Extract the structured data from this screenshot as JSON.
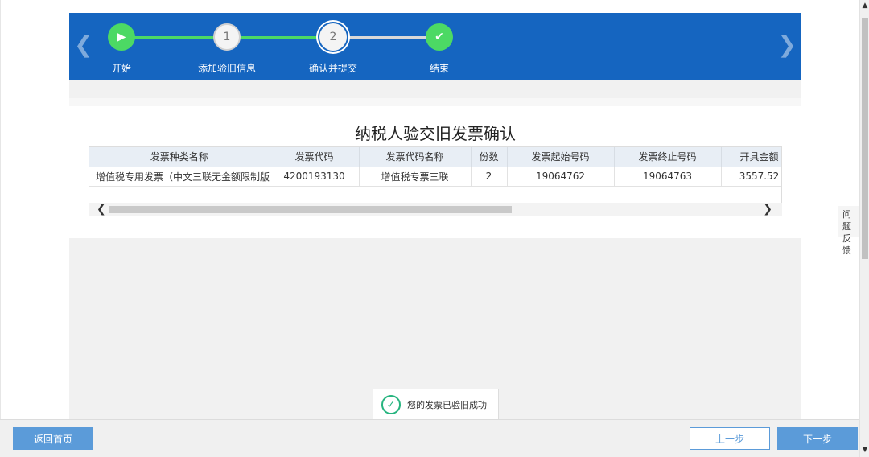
{
  "steps": [
    {
      "label": "开始",
      "marker": "▶",
      "state": "done"
    },
    {
      "label": "添加验旧信息",
      "marker": "1",
      "state": "pending"
    },
    {
      "label": "确认并提交",
      "marker": "2",
      "state": "current"
    },
    {
      "label": "结束",
      "marker": "✔",
      "state": "done"
    }
  ],
  "nav": {
    "prev_icon": "chevron-left-icon",
    "next_icon": "chevron-right-icon",
    "left_glyph": "❮",
    "right_glyph": "❯"
  },
  "main": {
    "title": "纳税人验交旧发票确认"
  },
  "table": {
    "columns": [
      "发票种类名称",
      "发票代码",
      "发票代码名称",
      "份数",
      "发票起始号码",
      "发票终止号码",
      "开具金额"
    ],
    "rows": [
      [
        "增值税专用发票（中文三联无金额限制版）",
        "4200193130",
        "增值税专票三联",
        "2",
        "19064762",
        "19064763",
        "3557.52"
      ]
    ]
  },
  "toast": {
    "message": "您的发票已验旧成功",
    "check": "✓"
  },
  "footer": {
    "home_label": "返回首页",
    "prev_label": "上一步",
    "next_label": "下一步"
  },
  "side": {
    "feedback_line1": "问题",
    "feedback_line2": "反馈"
  },
  "scroll": {
    "left": "❮",
    "right": "❯",
    "up": "▲",
    "down": "▼"
  },
  "colors": {
    "header_blue": "#1565c0",
    "step_done": "#4cd964",
    "button_blue": "#5b9bd9",
    "success_green": "#26b47f"
  }
}
